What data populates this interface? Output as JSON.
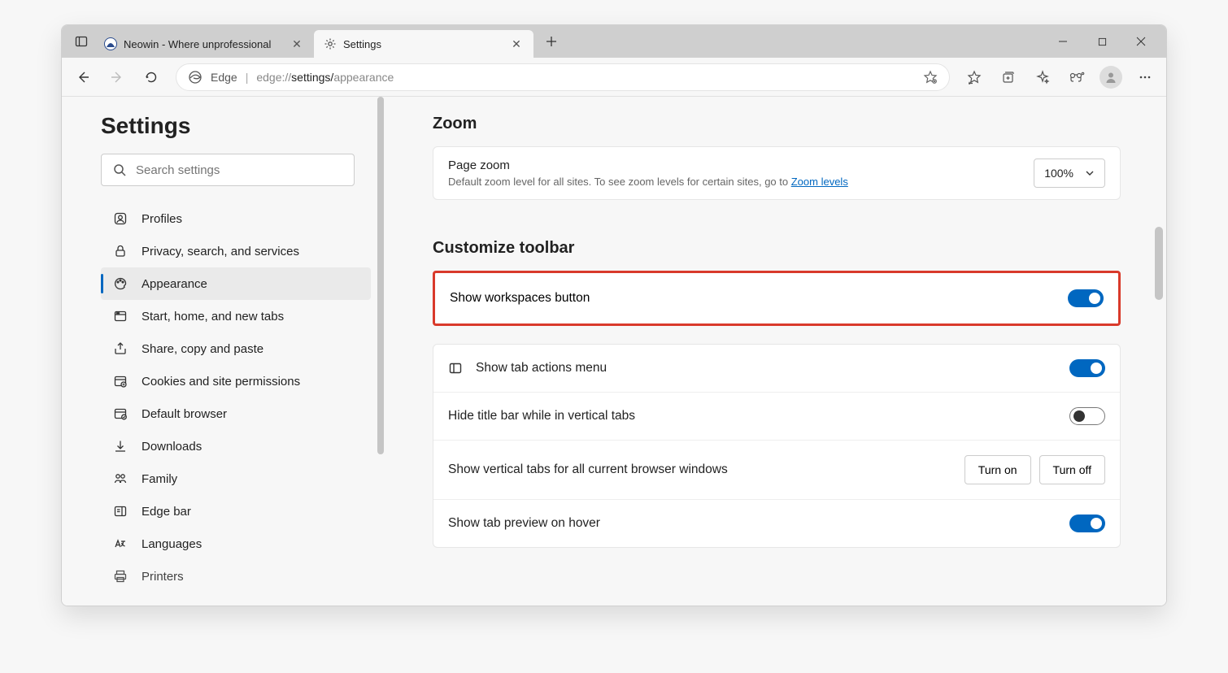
{
  "tabs": {
    "tab0_title": "Neowin - Where unprofessional",
    "tab1_title": "Settings"
  },
  "addr": {
    "label": "Edge",
    "url_prefix": "edge://",
    "url_mid": "settings/",
    "url_end": "appearance"
  },
  "sidebar": {
    "title": "Settings",
    "search_placeholder": "Search settings",
    "items": [
      "Profiles",
      "Privacy, search, and services",
      "Appearance",
      "Start, home, and new tabs",
      "Share, copy and paste",
      "Cookies and site permissions",
      "Default browser",
      "Downloads",
      "Family",
      "Edge bar",
      "Languages",
      "Printers"
    ]
  },
  "main": {
    "zoom_heading": "Zoom",
    "zoom_title": "Page zoom",
    "zoom_desc_a": "Default zoom level for all sites. To see zoom levels for certain sites, go to ",
    "zoom_desc_link": "Zoom levels",
    "zoom_value": "100%",
    "customize_heading": "Customize toolbar",
    "row_workspaces": "Show workspaces button",
    "row_tab_actions": "Show tab actions menu",
    "row_hide_titlebar": "Hide title bar while in vertical tabs",
    "row_vertical_tabs": "Show vertical tabs for all current browser windows",
    "row_tab_preview": "Show tab preview on hover",
    "turn_on": "Turn on",
    "turn_off": "Turn off"
  }
}
